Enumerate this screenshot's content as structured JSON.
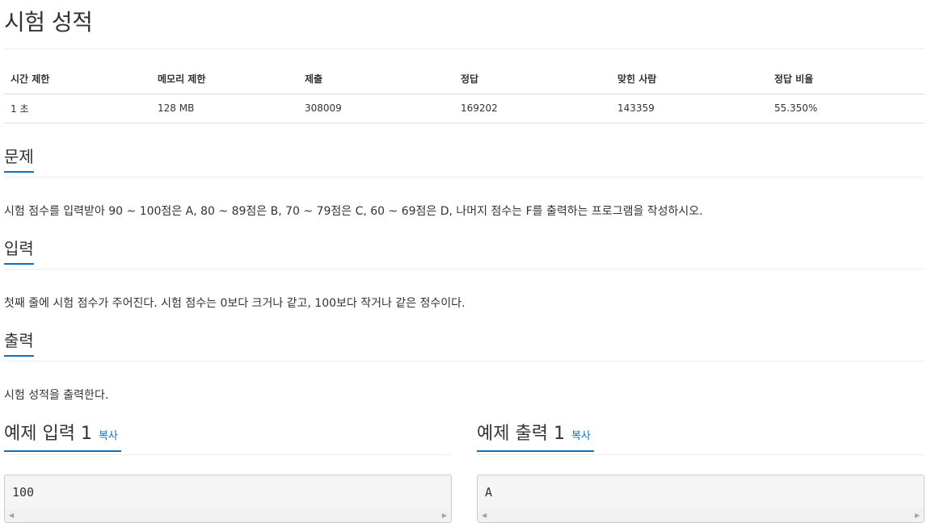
{
  "title": "시험 성적",
  "info": {
    "headers": [
      "시간 제한",
      "메모리 제한",
      "제출",
      "정답",
      "맞힌 사람",
      "정답 비율"
    ],
    "values": [
      "1 초",
      "128 MB",
      "308009",
      "169202",
      "143359",
      "55.350%"
    ]
  },
  "sections": {
    "problem": {
      "heading": "문제",
      "text": "시험 점수를 입력받아 90 ~ 100점은 A, 80 ~ 89점은 B, 70 ~ 79점은 C, 60 ~ 69점은 D, 나머지 점수는 F를 출력하는 프로그램을 작성하시오."
    },
    "input": {
      "heading": "입력",
      "text": "첫째 줄에 시험 점수가 주어진다. 시험 점수는 0보다 크거나 같고, 100보다 작거나 같은 정수이다."
    },
    "output": {
      "heading": "출력",
      "text": "시험 성적을 출력한다."
    }
  },
  "samples": {
    "input": {
      "heading": "예제 입력 1",
      "copy": "복사",
      "content": "100"
    },
    "output": {
      "heading": "예제 출력 1",
      "copy": "복사",
      "content": "A"
    }
  },
  "colors": {
    "accent": "#0e6fbf",
    "text": "#333333",
    "rule": "#eeeeee",
    "box_bg": "#f5f5f5"
  }
}
